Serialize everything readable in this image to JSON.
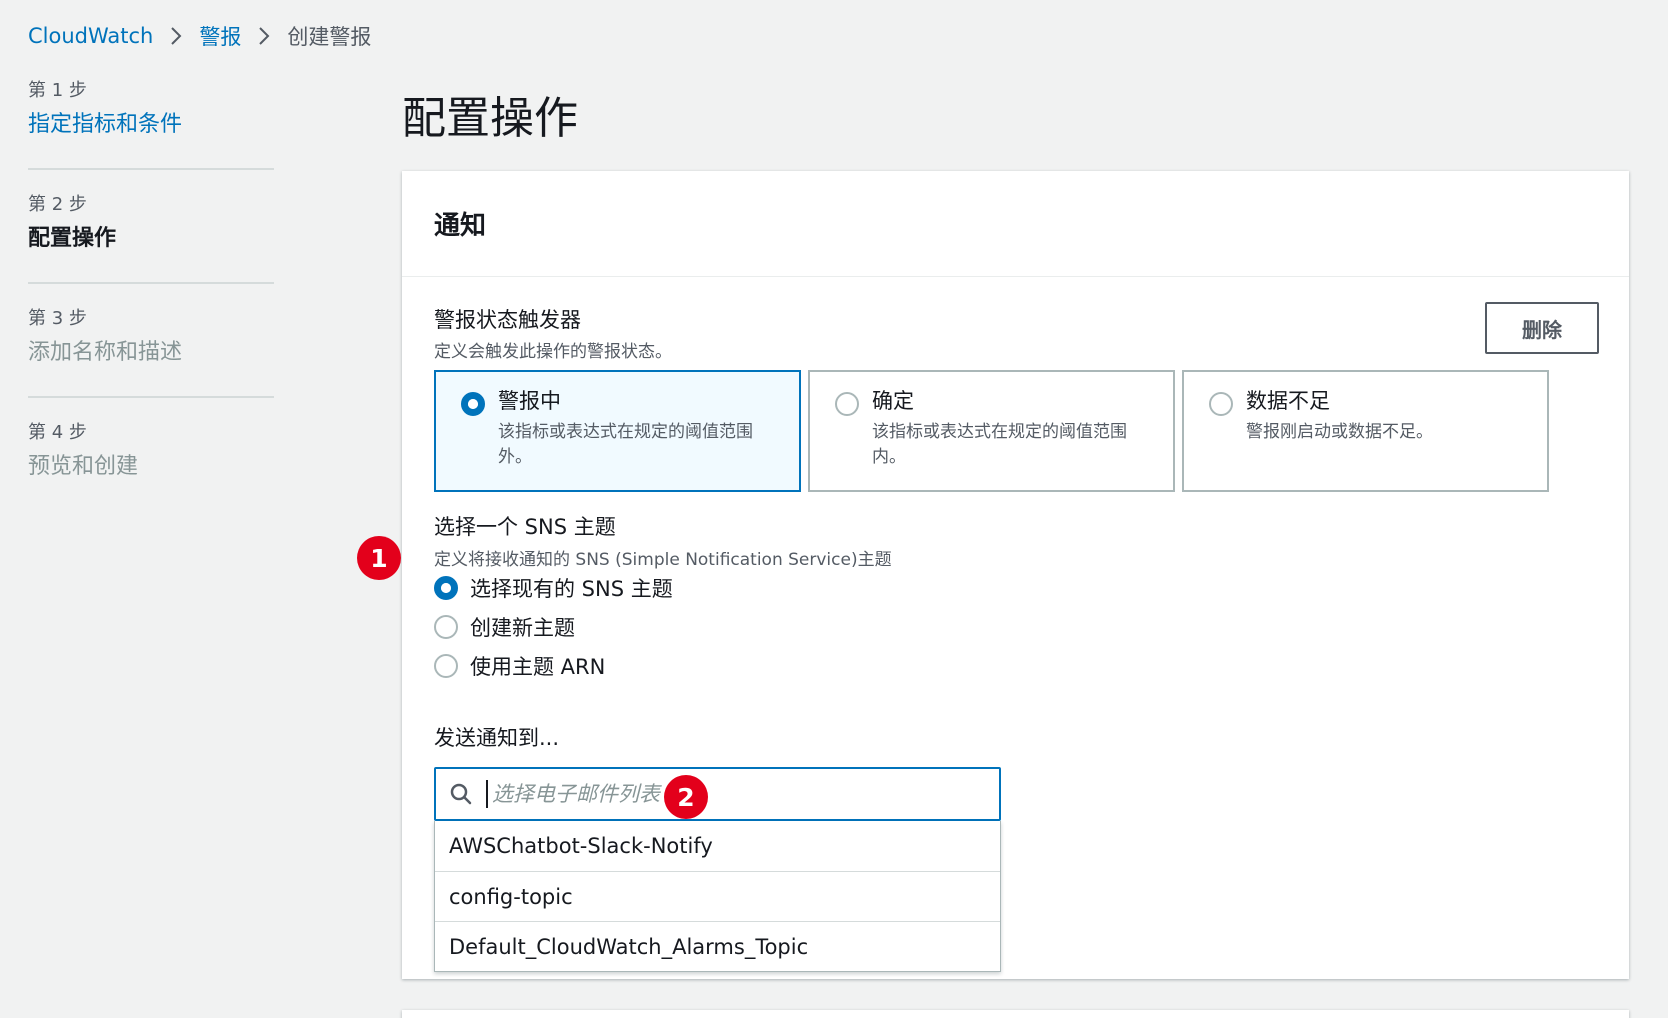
{
  "breadcrumb": {
    "items": [
      "CloudWatch",
      "警报",
      "创建警报"
    ]
  },
  "steps": [
    {
      "num": "第 1 步",
      "title": "指定指标和条件",
      "state": "link"
    },
    {
      "num": "第 2 步",
      "title": "配置操作",
      "state": "active"
    },
    {
      "num": "第 3 步",
      "title": "添加名称和描述",
      "state": "disabled"
    },
    {
      "num": "第 4 步",
      "title": "预览和创建",
      "state": "disabled"
    }
  ],
  "page_title": "配置操作",
  "panel": {
    "title": "通知",
    "trigger": {
      "label": "警报状态触发器",
      "description": "定义会触发此操作的警报状态。",
      "delete_label": "删除",
      "tiles": [
        {
          "label": "警报中",
          "desc": "该指标或表达式在规定的阈值范围外。",
          "selected": true
        },
        {
          "label": "确定",
          "desc": "该指标或表达式在规定的阈值范围内。",
          "selected": false
        },
        {
          "label": "数据不足",
          "desc": "警报刚启动或数据不足。",
          "selected": false
        }
      ]
    },
    "sns": {
      "label": "选择一个 SNS 主题",
      "description": "定义将接收通知的 SNS (Simple Notification Service)主题",
      "options": [
        {
          "label": "选择现有的 SNS 主题",
          "checked": true
        },
        {
          "label": "创建新主题",
          "checked": false
        },
        {
          "label": "使用主题 ARN",
          "checked": false
        }
      ]
    },
    "send_to": {
      "label": "发送通知到...",
      "placeholder": "选择电子邮件列表",
      "value": "",
      "dropdown": [
        "AWSChatbot-Slack-Notify",
        "config-topic",
        "Default_CloudWatch_Alarms_Topic"
      ]
    }
  },
  "annotations": [
    "1",
    "2"
  ],
  "colors": {
    "link": "#0073bb",
    "selected_bg": "#f1faff",
    "badge": "#e3001b",
    "page_bg": "#f1f2f2"
  }
}
